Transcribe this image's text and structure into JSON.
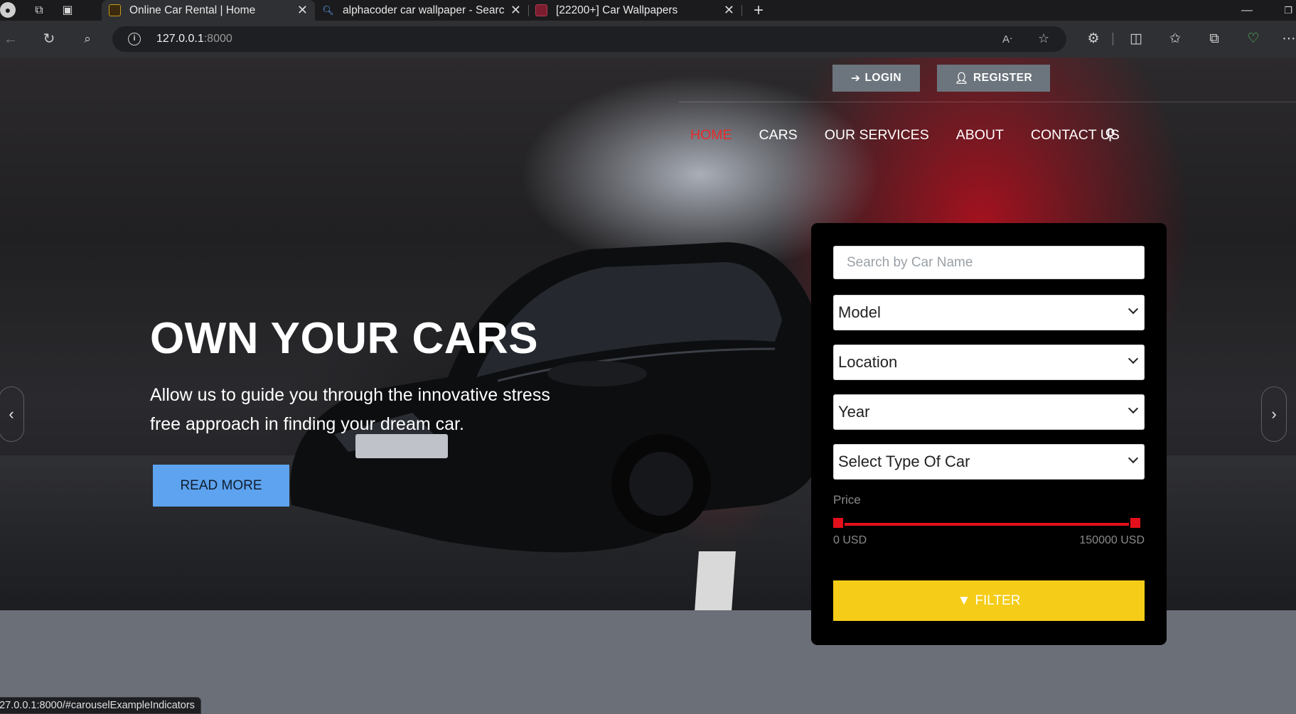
{
  "browser": {
    "tabs": [
      {
        "title": "Online Car Rental | Home",
        "active": true
      },
      {
        "title": "alphacoder car wallpaper - Searc",
        "active": false
      },
      {
        "title": "[22200+] Car Wallpapers",
        "active": false
      }
    ],
    "url_host": "127.0.0.1",
    "url_port": ":8000",
    "status_url": "127.0.0.1:8000/#carouselExampleIndicators"
  },
  "header": {
    "login_label": "LOGIN",
    "register_label": "REGISTER",
    "nav": [
      "HOME",
      "CARS",
      "OUR SERVICES",
      "ABOUT",
      "CONTACT US"
    ],
    "active_nav": "HOME"
  },
  "hero": {
    "title": "OWN YOUR CARS",
    "lead": "Allow us to guide you through the innovative stress free approach in finding your dream car.",
    "cta": "READ MORE"
  },
  "filter": {
    "search_placeholder": "Search by Car Name",
    "model": "Model",
    "location": "Location",
    "year": "Year",
    "type": "Select Type Of Car",
    "price_label": "Price",
    "price_min": "0 USD",
    "price_max": "150000 USD",
    "price_range_fraction": [
      0,
      1
    ],
    "button": "FILTER"
  },
  "colors": {
    "accent_red": "#e52b2b",
    "filter_yellow": "#f5cc17",
    "cta_blue": "#5ea3ef",
    "button_gray": "#6c757d"
  }
}
